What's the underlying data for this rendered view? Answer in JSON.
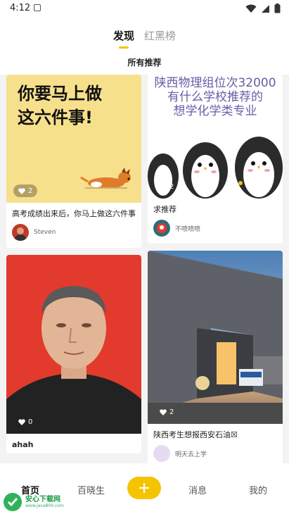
{
  "status_bar": {
    "time": "4:12"
  },
  "header": {
    "tabs": [
      {
        "label": "发现",
        "active": true
      },
      {
        "label": "红黑榜",
        "active": false
      }
    ],
    "subtitle": "所有推荐"
  },
  "feed": {
    "cards": [
      {
        "column": "left",
        "poster_lines": [
          "你要马上做",
          "这六件事!"
        ],
        "likes": "2",
        "title": "高考成绩出来后，你马上做这六件事",
        "author": "Steven"
      },
      {
        "column": "right",
        "poster_lines": [
          "陕西物理组位次32000",
          "有什么学校推荐的",
          "想学化学类专业"
        ],
        "likes": "2",
        "title": "求推荐",
        "author": "不啧啧啧"
      },
      {
        "column": "left",
        "likes": "0",
        "title": "ahah",
        "author": ""
      },
      {
        "column": "right",
        "likes": "2",
        "title": "陕西考生想报西安石油☒",
        "author": "明天去上学"
      }
    ]
  },
  "bottom_nav": {
    "items": [
      {
        "label": "首页",
        "active": true
      },
      {
        "label": "百晓生",
        "active": false
      },
      {
        "label": "消息",
        "active": false
      },
      {
        "label": "我的",
        "active": false
      }
    ],
    "fab_icon": "plus-icon"
  },
  "watermark": {
    "title": "安心下载网",
    "url": "www.java800.com"
  },
  "colors": {
    "accent": "#f5c400",
    "poster_yellow": "#f7e08c",
    "portrait_red": "#e23a2c"
  }
}
